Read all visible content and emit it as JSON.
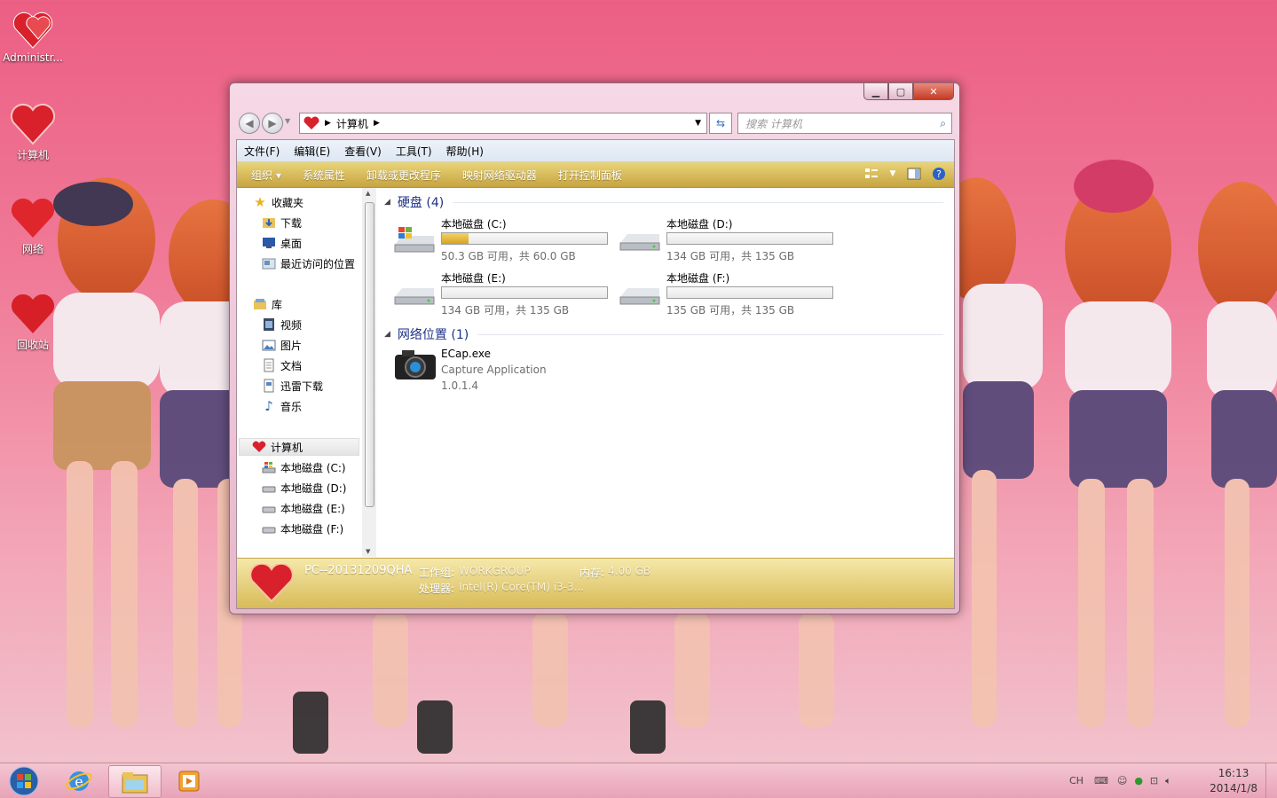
{
  "desktop": {
    "icons": [
      {
        "label": "Administr...",
        "icon": "user-heart-icon"
      },
      {
        "label": "计算机",
        "icon": "computer-heart-icon"
      },
      {
        "label": "网络",
        "icon": "network-heart-icon"
      },
      {
        "label": "回收站",
        "icon": "recycle-bin-heart-icon"
      }
    ]
  },
  "window": {
    "address": {
      "segment": "计算机"
    },
    "search_placeholder": "搜索 计算机",
    "menu": [
      "文件(F)",
      "编辑(E)",
      "查看(V)",
      "工具(T)",
      "帮助(H)"
    ],
    "toolbar": [
      "组织 ▾",
      "系统属性",
      "卸载或更改程序",
      "映射网络驱动器",
      "打开控制面板"
    ],
    "nav": {
      "favorites_label": "收藏夹",
      "favorites": [
        "下载",
        "桌面",
        "最近访问的位置"
      ],
      "libraries_label": "库",
      "libraries": [
        "视频",
        "图片",
        "文档",
        "迅雷下载",
        "音乐"
      ],
      "computer_label": "计算机",
      "drives": [
        "本地磁盘 (C:)",
        "本地磁盘 (D:)",
        "本地磁盘 (E:)",
        "本地磁盘 (F:)"
      ]
    },
    "groups": {
      "hard_disks": "硬盘 (4)",
      "network": "网络位置 (1)"
    },
    "drives": [
      {
        "name": "本地磁盘 (C:)",
        "space": "50.3 GB 可用，共 60.0 GB",
        "used_fraction": 0.16
      },
      {
        "name": "本地磁盘 (D:)",
        "space": "134 GB 可用，共 135 GB",
        "used_fraction": 0.0
      },
      {
        "name": "本地磁盘 (E:)",
        "space": "134 GB 可用，共 135 GB",
        "used_fraction": 0.0
      },
      {
        "name": "本地磁盘 (F:)",
        "space": "135 GB 可用，共 135 GB",
        "used_fraction": 0.0
      }
    ],
    "network_item": {
      "name": "ECap.exe",
      "desc": "Capture Application",
      "version": "1.0.1.4"
    },
    "status": {
      "pc_name": "PC--20131209QHA",
      "workgroup_label": "工作组:",
      "workgroup": "WORKGROUP",
      "memory_label": "内存:",
      "memory": "4.00 GB",
      "cpu_label": "处理器:",
      "cpu": "Intel(R) Core(TM) i3-3..."
    }
  },
  "taskbar": {
    "tray_lang": "CH",
    "time": "16:13",
    "date": "2014/1/8"
  },
  "colors": {
    "toolbar_gold": "#c7a440",
    "drive_fill": "#d4a520",
    "heart_red": "#d8212b",
    "wallpaper_pink": "#ec5f84"
  }
}
